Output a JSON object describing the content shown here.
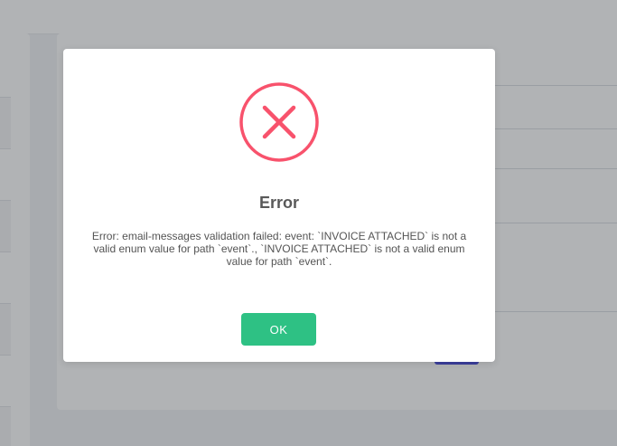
{
  "dialog": {
    "icon": "error-x-icon",
    "title": "Error",
    "message": "Error: email-messages validation failed: event: `INVOICE ATTACHED` is not a valid enum value for path `event`., `INVOICE ATTACHED` is not a valid enum value for path `event`.",
    "ok_label": "OK"
  },
  "colors": {
    "error_accent": "#f8526c",
    "ok_button": "#2ec184",
    "background_primary_button": "#3b3fd8"
  }
}
